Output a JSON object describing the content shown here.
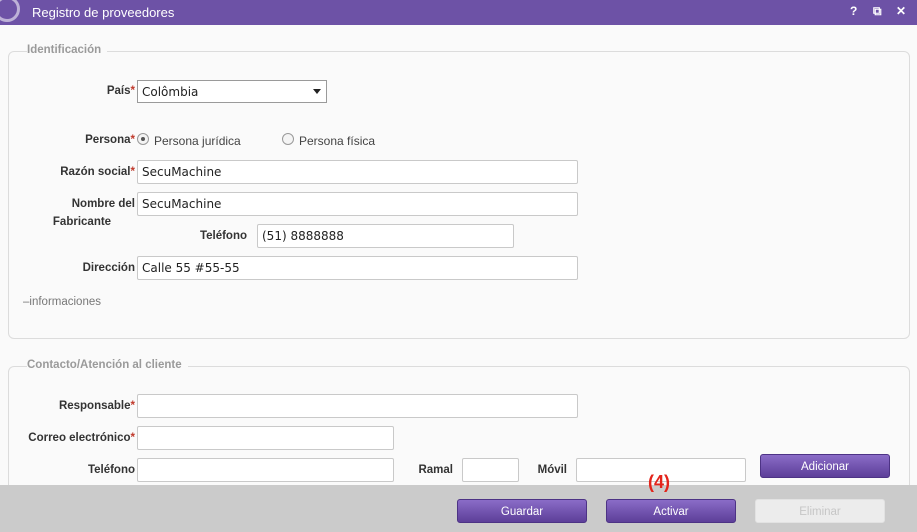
{
  "window": {
    "title": "Registro de proveedores",
    "help_label": "?",
    "maximize_label": "⧉",
    "close_label": "✕"
  },
  "identificacion": {
    "legend": "Identificación",
    "pais_label": "País",
    "pais_value": "Colômbia",
    "persona_label": "Persona",
    "persona_options": [
      "Persona jurídica",
      "Persona física"
    ],
    "persona_selected": "Persona jurídica",
    "razon_social_label": "Razón social",
    "razon_social_value": "SecuMachine",
    "nombre_fabricante_label_1": "Nombre del",
    "nombre_fabricante_label_2": "Fabricante",
    "nombre_fabricante_value": "SecuMachine",
    "telefono_label": "Teléfono",
    "telefono_value": "(51) 8888888",
    "direccion_label": "Dirección",
    "direccion_value": "Calle 55 #55-55",
    "informaciones_label": "informaciones",
    "required_mark": "*"
  },
  "contacto": {
    "legend": "Contacto/Atención al cliente",
    "responsable_label": "Responsable",
    "responsable_value": "",
    "correo_label": "Correo electrónico",
    "correo_value": "",
    "telefono_label": "Teléfono",
    "telefono_value": "",
    "ramal_label": "Ramal",
    "ramal_value": "",
    "movil_label": "Móvil",
    "movil_value": "",
    "adicionar_label": "Adicionar"
  },
  "footer": {
    "guardar_label": "Guardar",
    "activar_label": "Activar",
    "eliminar_label": "Eliminar",
    "step_marker": "(4)"
  },
  "colors": {
    "titlebar": "#6d52a6",
    "button": "#6a4fa8",
    "required": "#c0392b",
    "step_marker": "#e3241b"
  }
}
